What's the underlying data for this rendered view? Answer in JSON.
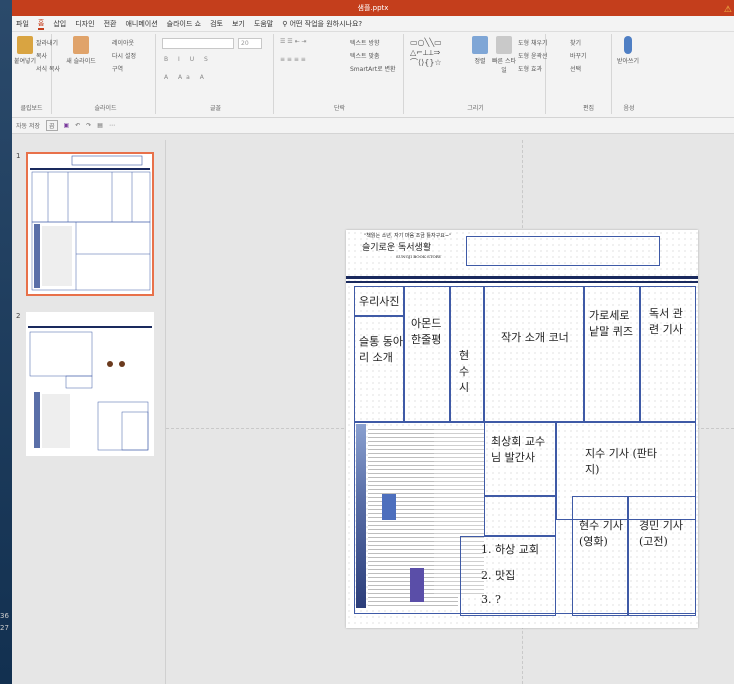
{
  "window": {
    "title": "샘플.pptx"
  },
  "tabs": [
    "파일",
    "홈",
    "삽입",
    "디자인",
    "전환",
    "애니메이션",
    "슬라이드 쇼",
    "검토",
    "보기",
    "도움말"
  ],
  "active_tab": "홈",
  "tell_me": "어떤 작업을 원하시나요?",
  "ribbon": {
    "clipboard": {
      "paste": "붙여넣기",
      "cut": "잘라내기",
      "copy": "복사",
      "format_painter": "서식 복사",
      "label": "클립보드"
    },
    "slides": {
      "new_slide": "새 슬라이드",
      "layout": "레이아웃",
      "reset": "다시 설정",
      "section": "구역",
      "label": "슬라이드"
    },
    "font": {
      "font_name": "",
      "font_size": "20",
      "label": "글꼴"
    },
    "paragraph": {
      "text_direction": "텍스트 방향",
      "align_text": "텍스트 맞춤",
      "smartart": "SmartArt로 변환",
      "label": "단락"
    },
    "drawing": {
      "arrange": "정렬",
      "quick_styles": "빠른 스타일",
      "shape_fill": "도형 채우기",
      "shape_outline": "도형 윤곽선",
      "shape_effects": "도형 효과",
      "label": "그리기"
    },
    "editing": {
      "find": "찾기",
      "replace": "바꾸기",
      "select": "선택",
      "label": "편집"
    },
    "voice": {
      "dictate": "받아쓰기",
      "label": "음성"
    }
  },
  "qat": {
    "autosave": "자동 저장",
    "autosave_state": "끔"
  },
  "thumbnails": [
    {
      "number": "1"
    },
    {
      "number": "2"
    }
  ],
  "left_strip": {
    "n1": "36",
    "n2": "27"
  },
  "slide": {
    "header_quote": "\"책읽는 소년, 자기 마음 조금 틀자구요~\"",
    "logo_text": "슬기로운 독서생활",
    "logo_sub": "SUNGJI BOOK STORY",
    "cells": {
      "photo": "우리사진",
      "club_intro": "슬통 동아리 소개",
      "review": "아몬드 한줄평",
      "poem": "현수 시",
      "author": "작가 소개 코너",
      "crossword": "가로세로 낱말 퀴즈",
      "reading_news": "독서 관련 기사",
      "professor": "최상회 교수님 발간사",
      "jisu": "지수 기사 (판타지)",
      "list1": "1. 하상 교회",
      "list2": "2. 맛집",
      "list3": "3. ?",
      "hyunsu_article": "현수 기사 (영화)",
      "kyungmin": "경민 기사 (고전)"
    }
  },
  "colors": {
    "title_bar": "#c43e1c",
    "slide_border": "#3f5aa6",
    "navy": "#1a2a5e",
    "selected_thumb": "#e8714a"
  }
}
